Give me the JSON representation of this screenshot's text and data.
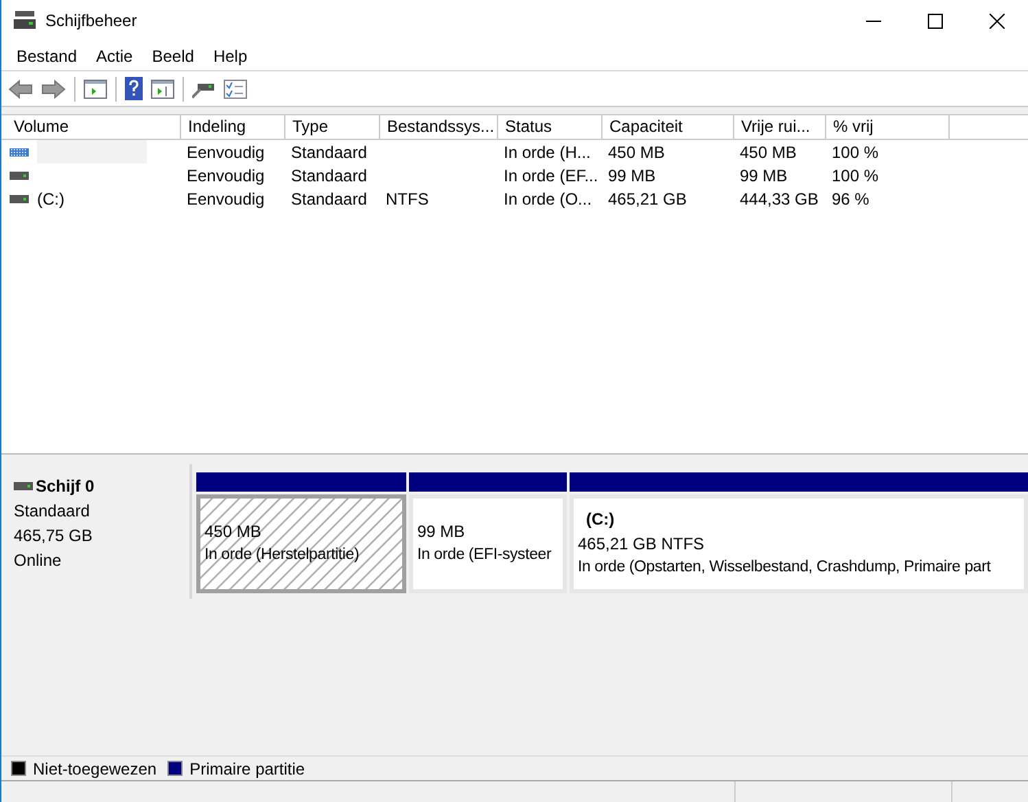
{
  "window": {
    "title": "Schijfbeheer"
  },
  "menu": [
    "Bestand",
    "Actie",
    "Beeld",
    "Help"
  ],
  "table": {
    "columns": [
      "Volume",
      "Indeling",
      "Type",
      "Bestandssys...",
      "Status",
      "Capaciteit",
      "Vrije rui...",
      "% vrij"
    ],
    "rows": [
      {
        "selected": true,
        "cells": [
          null,
          "Eenvoudig",
          "Standaard",
          null,
          "In orde (H...",
          "450 MB",
          "450 MB",
          "100 %"
        ]
      },
      {
        "selected": false,
        "cells": [
          null,
          "Eenvoudig",
          "Standaard",
          null,
          "In orde (EF...",
          "99 MB",
          "99 MB",
          "100 %"
        ]
      },
      {
        "selected": false,
        "cells": [
          "(C:)",
          "Eenvoudig",
          "Standaard",
          "NTFS",
          "In orde (O...",
          "465,21 GB",
          "444,33 GB",
          "96 %"
        ]
      }
    ]
  },
  "disk": {
    "name": "Schijf 0",
    "type": "Standaard",
    "size": "465,75 GB",
    "state": "Online",
    "partitions": [
      {
        "selected": true,
        "size": "450 MB",
        "status": "In orde (Herstelpartitie)"
      },
      {
        "selected": false,
        "size": "99 MB",
        "status": "In orde (EFI-systeer"
      },
      {
        "selected": false,
        "label": "(C:)",
        "size": "465,21 GB NTFS",
        "status": "In orde (Opstarten, Wisselbestand, Crashdump, Primaire part"
      }
    ]
  },
  "legend": [
    {
      "label": "Niet-toegewezen",
      "color": "#000000"
    },
    {
      "label": "Primaire partitie",
      "color": "#000080"
    }
  ]
}
